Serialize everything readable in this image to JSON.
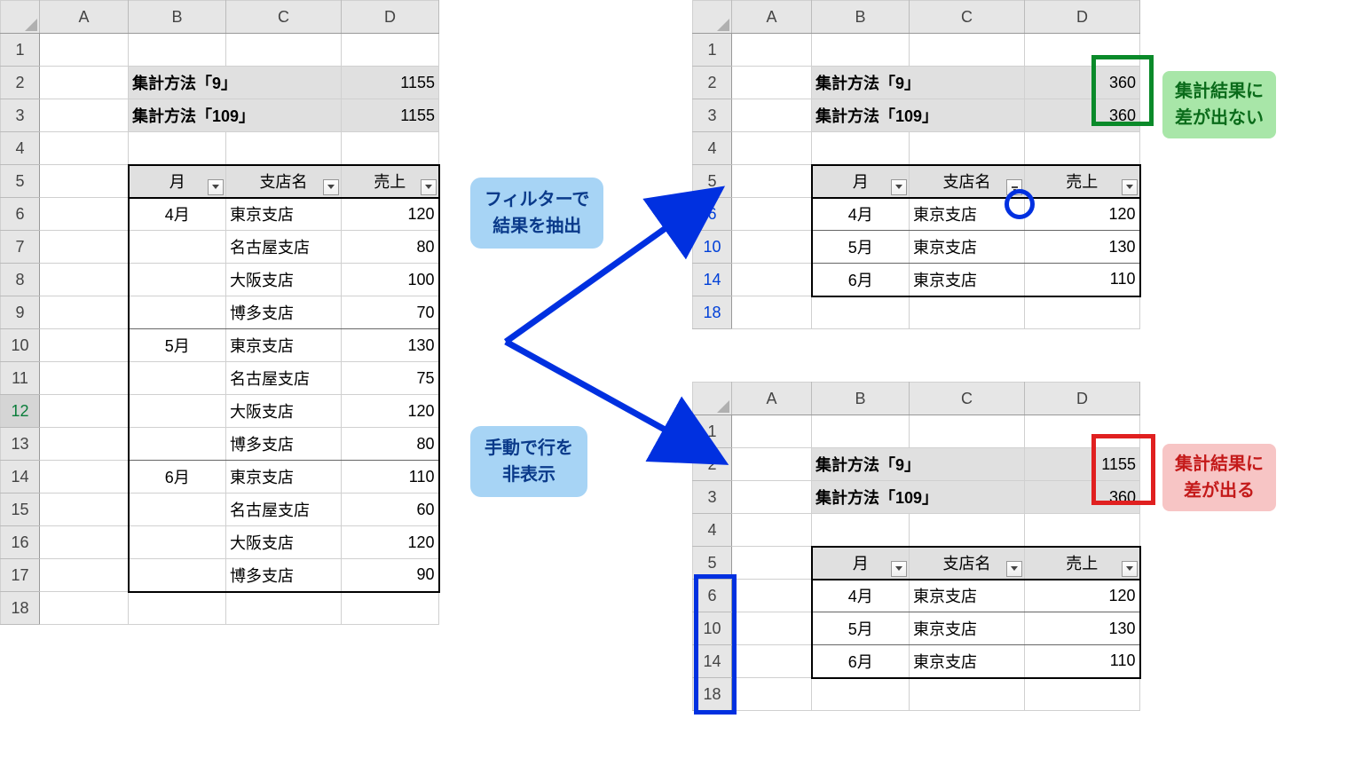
{
  "cols": [
    "A",
    "B",
    "C",
    "D"
  ],
  "left": {
    "rows": [
      "1",
      "2",
      "3",
      "4",
      "5",
      "6",
      "7",
      "8",
      "9",
      "10",
      "11",
      "12",
      "13",
      "14",
      "15",
      "16",
      "17",
      "18"
    ],
    "label9": "集計方法「9」",
    "label109": "集計方法「109」",
    "val9": "1155",
    "val109": "1155",
    "hdr_month": "月",
    "hdr_branch": "支店名",
    "hdr_sales": "売上",
    "data": [
      {
        "m": "4月",
        "b": "東京支店",
        "v": "120"
      },
      {
        "m": "",
        "b": "名古屋支店",
        "v": "80"
      },
      {
        "m": "",
        "b": "大阪支店",
        "v": "100"
      },
      {
        "m": "",
        "b": "博多支店",
        "v": "70"
      },
      {
        "m": "5月",
        "b": "東京支店",
        "v": "130"
      },
      {
        "m": "",
        "b": "名古屋支店",
        "v": "75"
      },
      {
        "m": "",
        "b": "大阪支店",
        "v": "120"
      },
      {
        "m": "",
        "b": "博多支店",
        "v": "80"
      },
      {
        "m": "6月",
        "b": "東京支店",
        "v": "110"
      },
      {
        "m": "",
        "b": "名古屋支店",
        "v": "60"
      },
      {
        "m": "",
        "b": "大阪支店",
        "v": "120"
      },
      {
        "m": "",
        "b": "博多支店",
        "v": "90"
      }
    ]
  },
  "top": {
    "rows": [
      "1",
      "2",
      "3",
      "4",
      "5",
      "6",
      "10",
      "14",
      "18"
    ],
    "val9": "360",
    "val109": "360",
    "data": [
      {
        "m": "4月",
        "b": "東京支店",
        "v": "120"
      },
      {
        "m": "5月",
        "b": "東京支店",
        "v": "130"
      },
      {
        "m": "6月",
        "b": "東京支店",
        "v": "110"
      }
    ]
  },
  "bottom": {
    "rows": [
      "1",
      "2",
      "3",
      "4",
      "5",
      "6",
      "10",
      "14",
      "18"
    ],
    "val9": "1155",
    "val109": "360",
    "data": [
      {
        "m": "4月",
        "b": "東京支店",
        "v": "120"
      },
      {
        "m": "5月",
        "b": "東京支店",
        "v": "130"
      },
      {
        "m": "6月",
        "b": "東京支店",
        "v": "110"
      }
    ]
  },
  "callouts": {
    "filter": "フィルターで\n結果を抽出",
    "manual": "手動で行を\n非表示"
  },
  "notes": {
    "nodiff": "集計結果に\n差が出ない",
    "diff": "集計結果に\n差が出る"
  }
}
